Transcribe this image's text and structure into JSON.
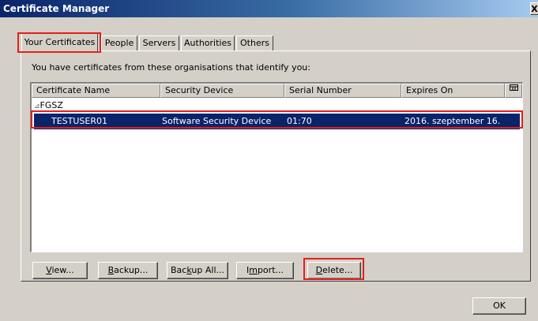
{
  "window": {
    "title": "Certificate Manager",
    "close_glyph": "X"
  },
  "tabs": [
    {
      "label": "Your Certificates",
      "active": true
    },
    {
      "label": "People",
      "active": false
    },
    {
      "label": "Servers",
      "active": false
    },
    {
      "label": "Authorities",
      "active": false
    },
    {
      "label": "Others",
      "active": false
    }
  ],
  "panel": {
    "info_text": "You have certificates from these organisations that identify you:"
  },
  "table": {
    "columns": [
      "Certificate Name",
      "Security Device",
      "Serial Number",
      "Expires On"
    ],
    "column_picker_icon": "column-picker-icon",
    "group": {
      "twisty": "⊿",
      "name": "FGSZ"
    },
    "rows": [
      {
        "certificate_name": "TESTUSER01",
        "security_device": "Software Security Device",
        "serial_number": "01:70",
        "expires_on": "2016. szeptember 16.",
        "selected": true
      }
    ]
  },
  "buttons": {
    "view": {
      "mnemonic": "V",
      "rest": "iew..."
    },
    "backup": {
      "mnemonic": "B",
      "rest": "ackup..."
    },
    "backup_all": {
      "pre": "Bac",
      "mnemonic": "k",
      "rest": "up All..."
    },
    "import": {
      "pre": "I",
      "mnemonic": "m",
      "rest": "port..."
    },
    "delete": {
      "mnemonic": "D",
      "rest": "elete..."
    },
    "ok": "OK"
  },
  "highlight_color": "#e0201b",
  "selection_color": "#0a246a"
}
